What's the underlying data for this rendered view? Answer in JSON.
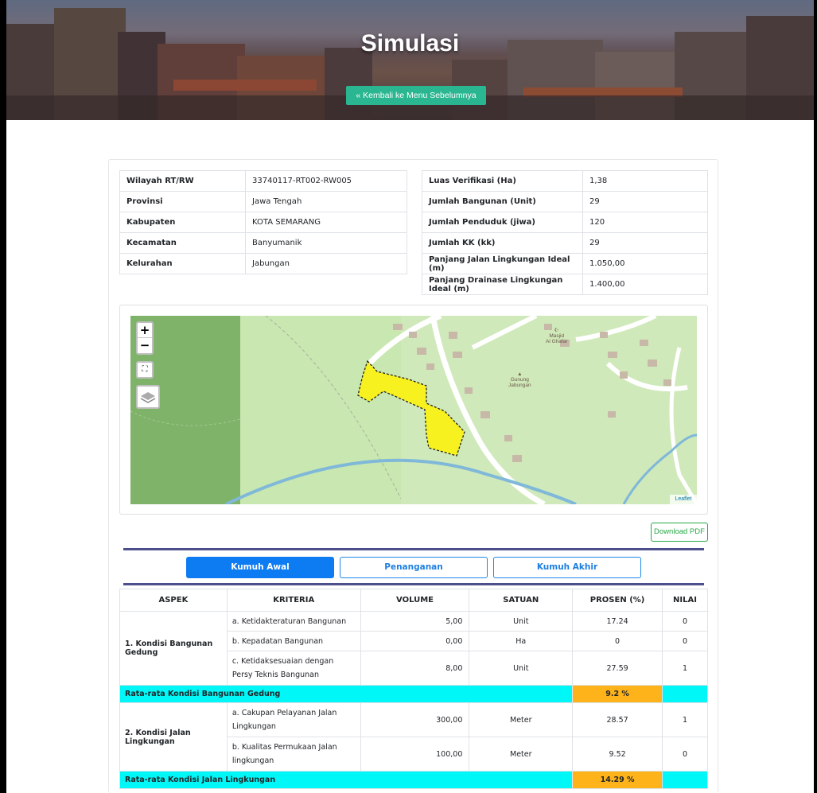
{
  "header": {
    "title": "Simulasi",
    "back_label": "« Kembali ke Menu Sebelumnya"
  },
  "info_left": [
    {
      "label": "Wilayah RT/RW",
      "value": "33740117-RT002-RW005"
    },
    {
      "label": "Provinsi",
      "value": "Jawa Tengah"
    },
    {
      "label": "Kabupaten",
      "value": "KOTA SEMARANG"
    },
    {
      "label": "Kecamatan",
      "value": "Banyumanik"
    },
    {
      "label": "Kelurahan",
      "value": "Jabungan"
    }
  ],
  "info_right": [
    {
      "label": "Luas Verifikasi (Ha)",
      "value": "1,38"
    },
    {
      "label": "Jumlah Bangunan (Unit)",
      "value": "29"
    },
    {
      "label": "Jumlah Penduduk (jiwa)",
      "value": "120"
    },
    {
      "label": "Jumlah KK (kk)",
      "value": "29"
    },
    {
      "label": "Panjang Jalan Lingkungan Ideal (m)",
      "value": "1.050,00"
    },
    {
      "label": "Panjang Drainase Lingkungan Ideal (m)",
      "value": "1.400,00"
    }
  ],
  "map": {
    "zoom_in": "+",
    "zoom_out": "−",
    "fullscreen_icon": "fullscreen-icon",
    "layers_icon": "layers-icon",
    "attribution": "Leaflet",
    "labels": {
      "mosque": "Masjid\nAl Ghafar",
      "hill": "Gunung\nJabungan"
    },
    "colors": {
      "area_fill": "#f7f21f",
      "river": "#7fb8d8",
      "forest": "#7fb36a"
    }
  },
  "download_label": "Download PDF",
  "tabs": [
    {
      "label": "Kumuh Awal",
      "active": true
    },
    {
      "label": "Penanganan",
      "active": false
    },
    {
      "label": "Kumuh Akhir",
      "active": false
    }
  ],
  "table": {
    "headers": [
      "ASPEK",
      "KRITERIA",
      "VOLUME",
      "SATUAN",
      "PROSEN (%)",
      "NILAI"
    ],
    "group1": {
      "aspek": "1. Kondisi Bangunan Gedung",
      "rows": [
        {
          "kriteria": "a. Ketidakteraturan Bangunan",
          "volume": "5,00",
          "satuan": "Unit",
          "prosen": "17.24",
          "nilai": "0"
        },
        {
          "kriteria": "b. Kepadatan Bangunan",
          "volume": "0,00",
          "satuan": "Ha",
          "prosen": "0",
          "nilai": "0"
        },
        {
          "kriteria": "c. Ketidaksesuaian dengan Persy Teknis Bangunan",
          "volume": "8,00",
          "satuan": "Unit",
          "prosen": "27.59",
          "nilai": "1"
        }
      ],
      "avg_label": "Rata-rata Kondisi Bangunan Gedung",
      "avg_value": "9.2 %"
    },
    "group2": {
      "aspek": "2. Kondisi Jalan Lingkungan",
      "rows": [
        {
          "kriteria": "a. Cakupan Pelayanan Jalan Lingkungan",
          "volume": "300,00",
          "satuan": "Meter",
          "prosen": "28.57",
          "nilai": "1"
        },
        {
          "kriteria": "b. Kualitas Permukaan Jalan lingkungan",
          "volume": "100,00",
          "satuan": "Meter",
          "prosen": "9.52",
          "nilai": "0"
        }
      ],
      "avg_label": "Rata-rata Kondisi Jalan Lingkungan",
      "avg_value": "14.29 %"
    }
  }
}
